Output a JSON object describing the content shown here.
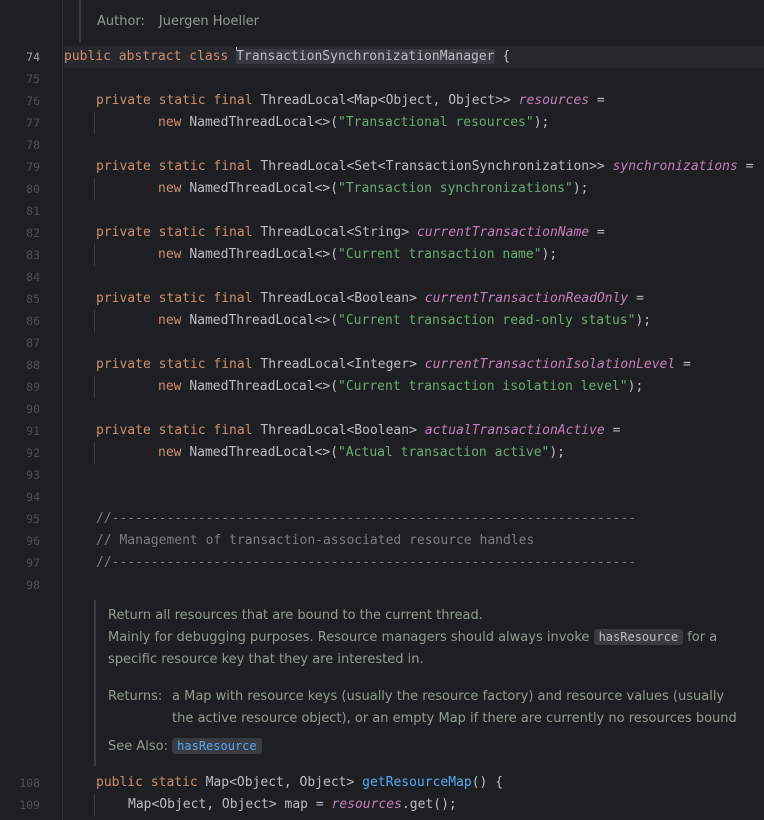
{
  "top_doc": {
    "author_label": "Author:",
    "author_value": "Juergen Hoeller"
  },
  "gutter": {
    "line_numbers": [
      "74",
      "75",
      "76",
      "77",
      "78",
      "79",
      "80",
      "81",
      "82",
      "83",
      "84",
      "85",
      "86",
      "87",
      "88",
      "89",
      "90",
      "91",
      "92",
      "93",
      "94",
      "95",
      "96",
      "97",
      "98",
      "108",
      "109"
    ]
  },
  "code": {
    "class_decl": {
      "kw1": "public",
      "kw2": "abstract",
      "kw3": "class",
      "name": "TransactionSynchronizationManager",
      "brace": " {"
    },
    "mods": "private static final",
    "new_kw": "new",
    "named_tl": "NamedThreadLocal<>(",
    "close": ");",
    "fields": [
      {
        "type": "ThreadLocal<Map<Object, Object>>",
        "name": "resources",
        "eq": " =",
        "str": "\"Transactional resources\""
      },
      {
        "type": "ThreadLocal<Set<TransactionSynchronization>>",
        "name": "synchronizations",
        "eq": " =",
        "str": "\"Transaction synchronizations\""
      },
      {
        "type": "ThreadLocal<String>",
        "name": "currentTransactionName",
        "eq": " =",
        "str": "\"Current transaction name\""
      },
      {
        "type": "ThreadLocal<Boolean>",
        "name": "currentTransactionReadOnly",
        "eq": " =",
        "str": "\"Current transaction read-only status\""
      },
      {
        "type": "ThreadLocal<Integer>",
        "name": "currentTransactionIsolationLevel",
        "eq": " =",
        "str": "\"Current transaction isolation level\""
      },
      {
        "type": "ThreadLocal<Boolean>",
        "name": "actualTransactionActive",
        "eq": " =",
        "str": "\"Actual transaction active\""
      }
    ],
    "comment_rule": "//-------------------------------------------------------------------",
    "comment_text": "// Management of transaction-associated resource handles",
    "method_decl": {
      "kw1": "public",
      "kw2": "static",
      "type": "Map<Object, Object>",
      "name": "getResourceMap",
      "rest": "() {"
    },
    "method_body": {
      "type": "Map<Object, Object> map = ",
      "field": "resources",
      "rest": ".get();"
    }
  },
  "javadoc": {
    "line1": "Return all resources that are bound to the current thread.",
    "line2a": "Mainly for debugging purposes. Resource managers should always invoke",
    "line2_code": "hasResource",
    "line2b": "for a",
    "line3": "specific resource key that they are interested in.",
    "returns_label": "Returns:",
    "returns_text1": "a Map with resource keys (usually the resource factory) and resource values (usually",
    "returns_text2": "the active resource object), or an empty Map if there are currently no resources bound",
    "see_also_label": "See Also:",
    "see_also_link": "hasResource"
  }
}
